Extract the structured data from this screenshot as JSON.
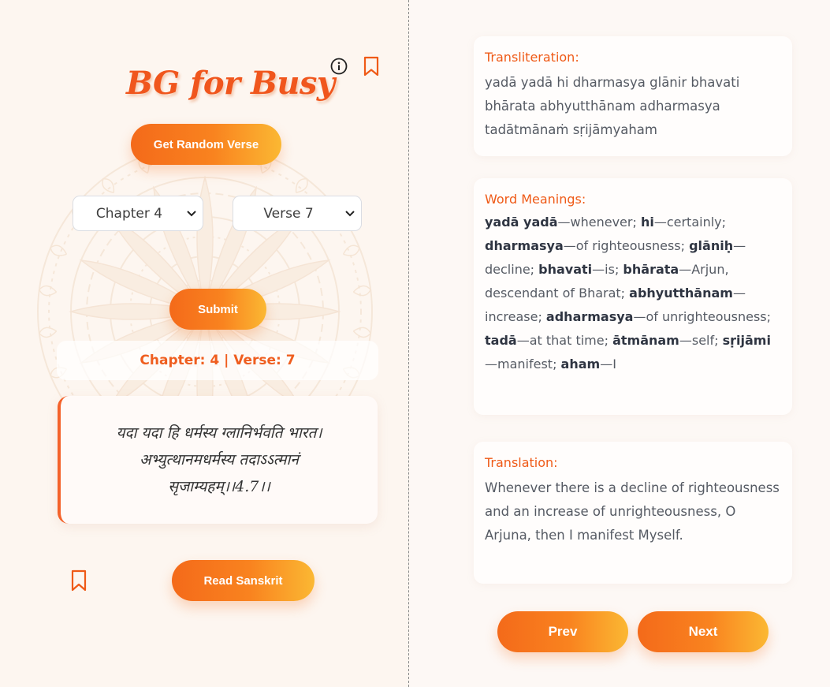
{
  "app": {
    "title": "BG for Busy"
  },
  "icons": {
    "info": "info-icon",
    "bookmark": "bookmark-icon",
    "chevron": "chevron-down-icon"
  },
  "colors": {
    "accent": "#f0561d",
    "gradient_start": "#f46a1a",
    "gradient_end": "#fbb833",
    "background": "#fdf7f2"
  },
  "controls": {
    "random_label": "Get Random Verse",
    "chapter_selected": "Chapter 4",
    "verse_selected": "Verse 7",
    "submit_label": "Submit",
    "read_sanskrit_label": "Read Sanskrit"
  },
  "verse": {
    "reference": "Chapter: 4 | Verse: 7",
    "sanskrit": "यदा यदा हि धर्मस्य ग्लानिर्भवति भारत।\nअभ्युत्थानमधर्मस्य तदाऽऽत्मानं\nसृजाम्यहम्।।4.7।।",
    "transliteration_heading": "Transliteration:",
    "transliteration": "yadā yadā hi dharmasya glānir bhavati bhārata abhyutthānam adharmasya tadātmānaṁ sṛijāmyaham",
    "meanings_heading": "Word Meanings:",
    "meanings": [
      {
        "term": "yadā yadā",
        "meaning": "whenever"
      },
      {
        "term": "hi",
        "meaning": "certainly"
      },
      {
        "term": "dharmasya",
        "meaning": "of righteousness"
      },
      {
        "term": "glāniḥ",
        "meaning": "decline"
      },
      {
        "term": "bhavati",
        "meaning": "is"
      },
      {
        "term": "bhārata",
        "meaning": "Arjun, descendant of Bharat"
      },
      {
        "term": "abhyutthānam",
        "meaning": "increase"
      },
      {
        "term": "adharmasya",
        "meaning": "of unrighteousness"
      },
      {
        "term": "tadā",
        "meaning": "at that time"
      },
      {
        "term": "ātmānam",
        "meaning": "self"
      },
      {
        "term": "sṛijāmi",
        "meaning": "manifest"
      },
      {
        "term": "aham",
        "meaning": "I"
      }
    ],
    "translation_heading": "Translation:",
    "translation": "Whenever there is a decline of righteousness and an increase of unrighteousness, O Arjuna, then I manifest Myself."
  },
  "navigation": {
    "prev_label": "Prev",
    "next_label": "Next"
  }
}
